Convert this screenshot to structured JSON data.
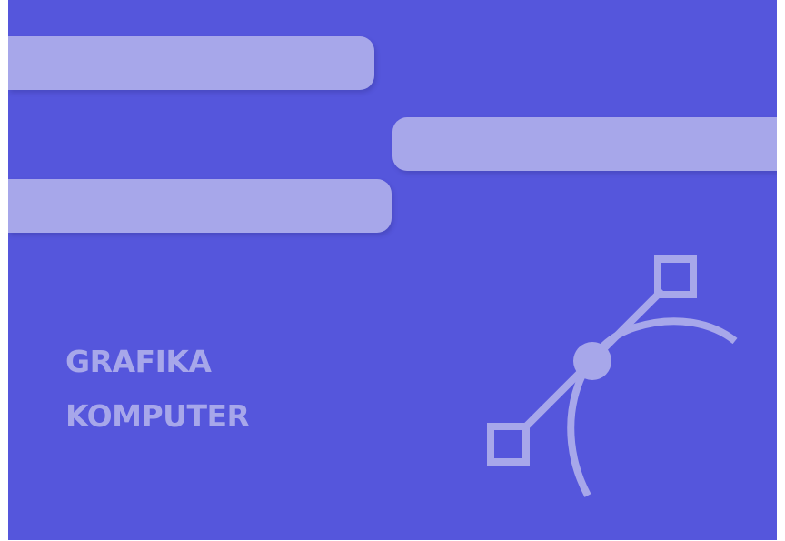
{
  "cover": {
    "title_line_1": "GRAFIKA",
    "title_line_2": "KOMPUTER",
    "icon": "bezier-pen-tool-icon"
  },
  "colors": {
    "background": "#5556dc",
    "accent": "#a7a7ea",
    "page": "#ffffff"
  }
}
